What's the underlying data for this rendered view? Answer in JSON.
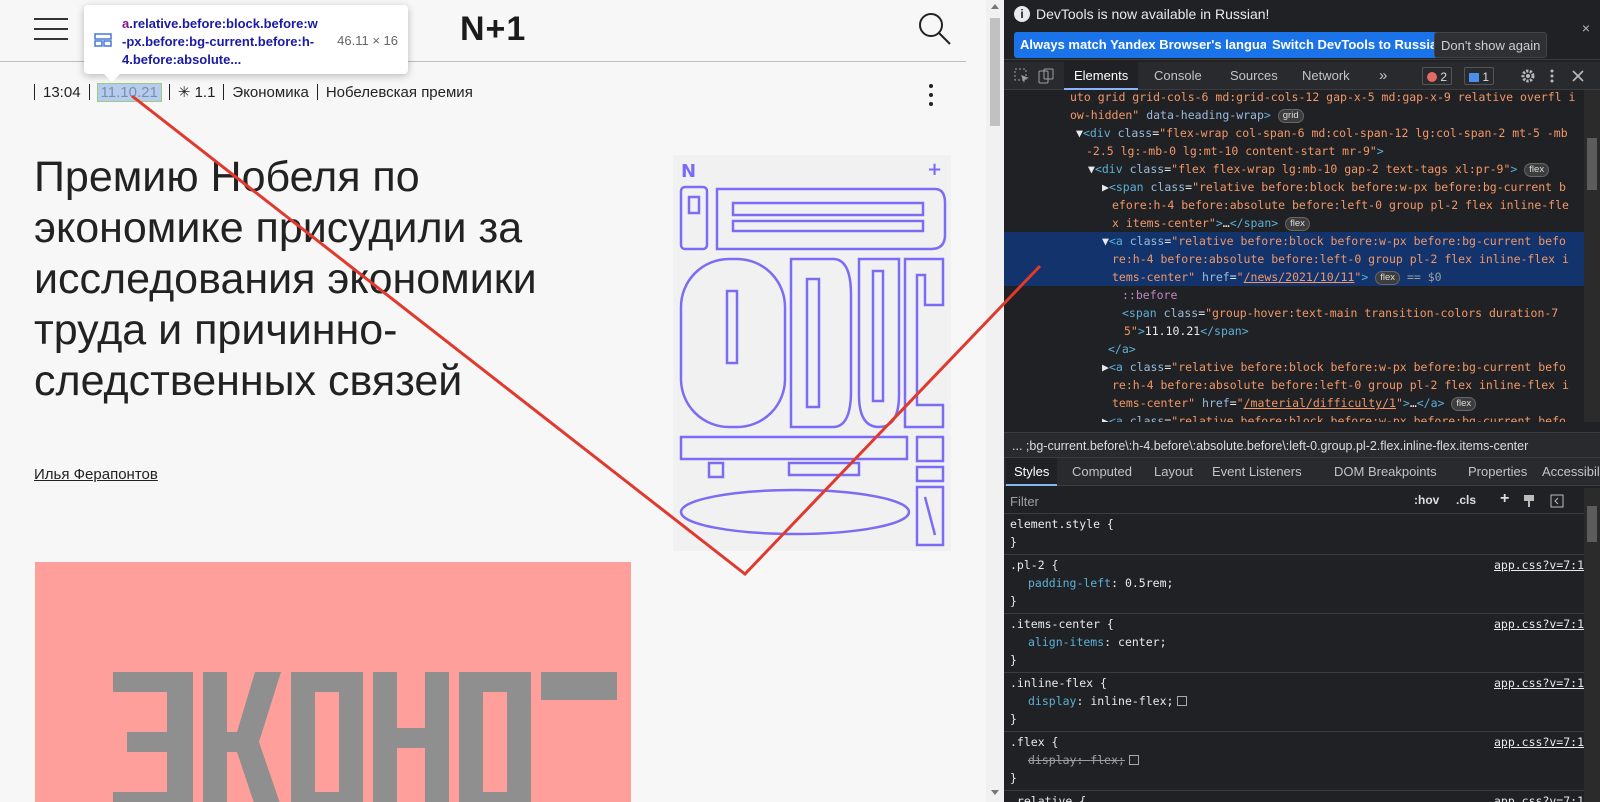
{
  "page": {
    "logo": "N+1",
    "tooltip": {
      "selector_tag": "a",
      "selector_rest": ".relative.before:block.before:w-px.before:bg-current.before:h-4.before:absolute...",
      "size": "46.11 × 16"
    },
    "meta": {
      "time": "13:04",
      "date": "11.10.21",
      "difficulty": "✳ 1.1",
      "tags": [
        "Экономика",
        "Нобелевская премия"
      ]
    },
    "headline": "Премию Нобеля по экономике присудили за исследования экономики труда и причинно-следственных связей",
    "author": "Илья Ферапонтов",
    "colors": {
      "hero_bg": "#ff9f9c",
      "poster_stroke": "#7b6cf6",
      "annotation": "#e03a2f"
    }
  },
  "devtools": {
    "info_text": "DevTools is now available in Russian!",
    "info_buttons": [
      "Always match Yandex Browser's language",
      "Switch DevTools to Russian",
      "Don't show again"
    ],
    "info_close": "×",
    "tabs": [
      "Elements",
      "Console",
      "Sources",
      "Network"
    ],
    "more_tabs": "»",
    "errors": "2",
    "messages": "1",
    "dom_lines": [
      {
        "html": "<span class=\"v\">uto grid grid-cols-6 md:grid-cols-12 gap-x-5 md:gap-x-9 relative overfl i</span>"
      },
      {
        "html": "<span class=\"v\">ow-hidden\"</span> <span class=\"a\">data-heading-wrap</span><span class=\"t\">&gt;</span> <span class=\"flex-badge\">grid</span>"
      },
      {
        "html": "▼<span class=\"t\">&lt;div</span> <span class=\"a\">class</span>=<span class=\"v\">\"flex-wrap col-span-6 md:col-span-12 lg:col-span-2 mt-5 -mb</span>"
      },
      {
        "html": "<span class=\"v\">-2.5 lg:-mb-0 lg:mt-10 content-start mr-9\"</span><span class=\"t\">&gt;</span>"
      },
      {
        "html": "▼<span class=\"t\">&lt;div</span> <span class=\"a\">class</span>=<span class=\"v\">\"flex flex-wrap lg:mb-10 gap-2 text-tags xl:pr-9\"</span><span class=\"t\">&gt;</span> <span class=\"flex-badge\">flex</span>"
      },
      {
        "html": "▶<span class=\"t\">&lt;span</span> <span class=\"a\">class</span>=<span class=\"v\">\"relative before:block before:w-px before:bg-current b</span>"
      },
      {
        "html": "<span class=\"v\">efore:h-4 before:absolute before:left-0 group pl-2 flex inline-fle</span>"
      },
      {
        "html": "<span class=\"v\">x items-center\"</span><span class=\"t\">&gt;</span>…<span class=\"t\">&lt;/span&gt;</span> <span class=\"flex-badge\">flex</span>"
      },
      {
        "html": "▼<span class=\"t\">&lt;a</span> <span class=\"a\">class</span>=<span class=\"v\">\"relative before:block before:w-px before:bg-current befo</span>"
      },
      {
        "html": "<span class=\"v\">re:h-4 before:absolute before:left-0 group pl-2 flex inline-flex i</span>"
      },
      {
        "html": "<span class=\"v\">tems-center\"</span> <span class=\"a\">href</span>=<span class=\"v\">\"<u>/news/2021/10/11</u>\"</span><span class=\"t\">&gt;</span> <span class=\"flex-badge\">flex</span> <span style=\"color:#9aa0a6\">== $0</span>"
      },
      {
        "html": "<span class=\"pseudo\">::before</span>"
      },
      {
        "html": "<span class=\"t\">&lt;span</span> <span class=\"a\">class</span>=<span class=\"v\">\"group-hover:text-main transition-colors duration-7</span>"
      },
      {
        "html": "<span class=\"v\">5\"</span><span class=\"t\">&gt;</span>11.10.21<span class=\"t\">&lt;/span&gt;</span>"
      },
      {
        "html": "<span class=\"t\">&lt;/a&gt;</span>"
      },
      {
        "html": "▶<span class=\"t\">&lt;a</span> <span class=\"a\">class</span>=<span class=\"v\">\"relative before:block before:w-px before:bg-current befo</span>"
      },
      {
        "html": "<span class=\"v\">re:h-4 before:absolute before:left-0 group pl-2 flex inline-flex i</span>"
      },
      {
        "html": "<span class=\"v\">tems-center\"</span> <span class=\"a\">href</span>=<span class=\"v\">\"<u>/material/difficulty/1</u>\"</span><span class=\"t\">&gt;</span>…<span class=\"t\">&lt;/a&gt;</span> <span class=\"flex-badge\">flex</span>"
      },
      {
        "html": "▶<span class=\"t\">&lt;a</span> <span class=\"a\">class</span>=<span class=\"v\">\"relative before:block before:w-px before:bg-current befo</span>"
      }
    ],
    "breadcrumb": ";bg-current.before\\:h-4.before\\:absolute.before\\:left-0.group.pl-2.flex.inline-flex.items-center",
    "breadcrumb_more": "...",
    "styles_tabs": [
      "Styles",
      "Computed",
      "Layout",
      "Event Listeners",
      "DOM Breakpoints",
      "Properties",
      "Accessibility"
    ],
    "filter_placeholder": "Filter",
    "hov": ":hov",
    "cls": ".cls",
    "rules": [
      {
        "selector": "element.style {",
        "source": "",
        "decls": []
      },
      {
        "selector": ".pl-2 {",
        "source": "app.css?v=7:1",
        "decls": [
          {
            "prop": "padding-left",
            "value": "0.5rem;",
            "struck": false
          }
        ]
      },
      {
        "selector": ".items-center {",
        "source": "app.css?v=7:1",
        "decls": [
          {
            "prop": "align-items",
            "value": "center;",
            "struck": false
          }
        ]
      },
      {
        "selector": ".inline-flex {",
        "source": "app.css?v=7:1",
        "decls": [
          {
            "prop": "display",
            "value": "inline-flex;",
            "struck": false
          }
        ]
      },
      {
        "selector": ".flex {",
        "source": "app.css?v=7:1",
        "decls": [
          {
            "prop": "display",
            "value": "flex;",
            "struck": true
          }
        ]
      },
      {
        "selector": ".relative {",
        "source": "app.css?v=7:1",
        "decls": []
      }
    ]
  }
}
